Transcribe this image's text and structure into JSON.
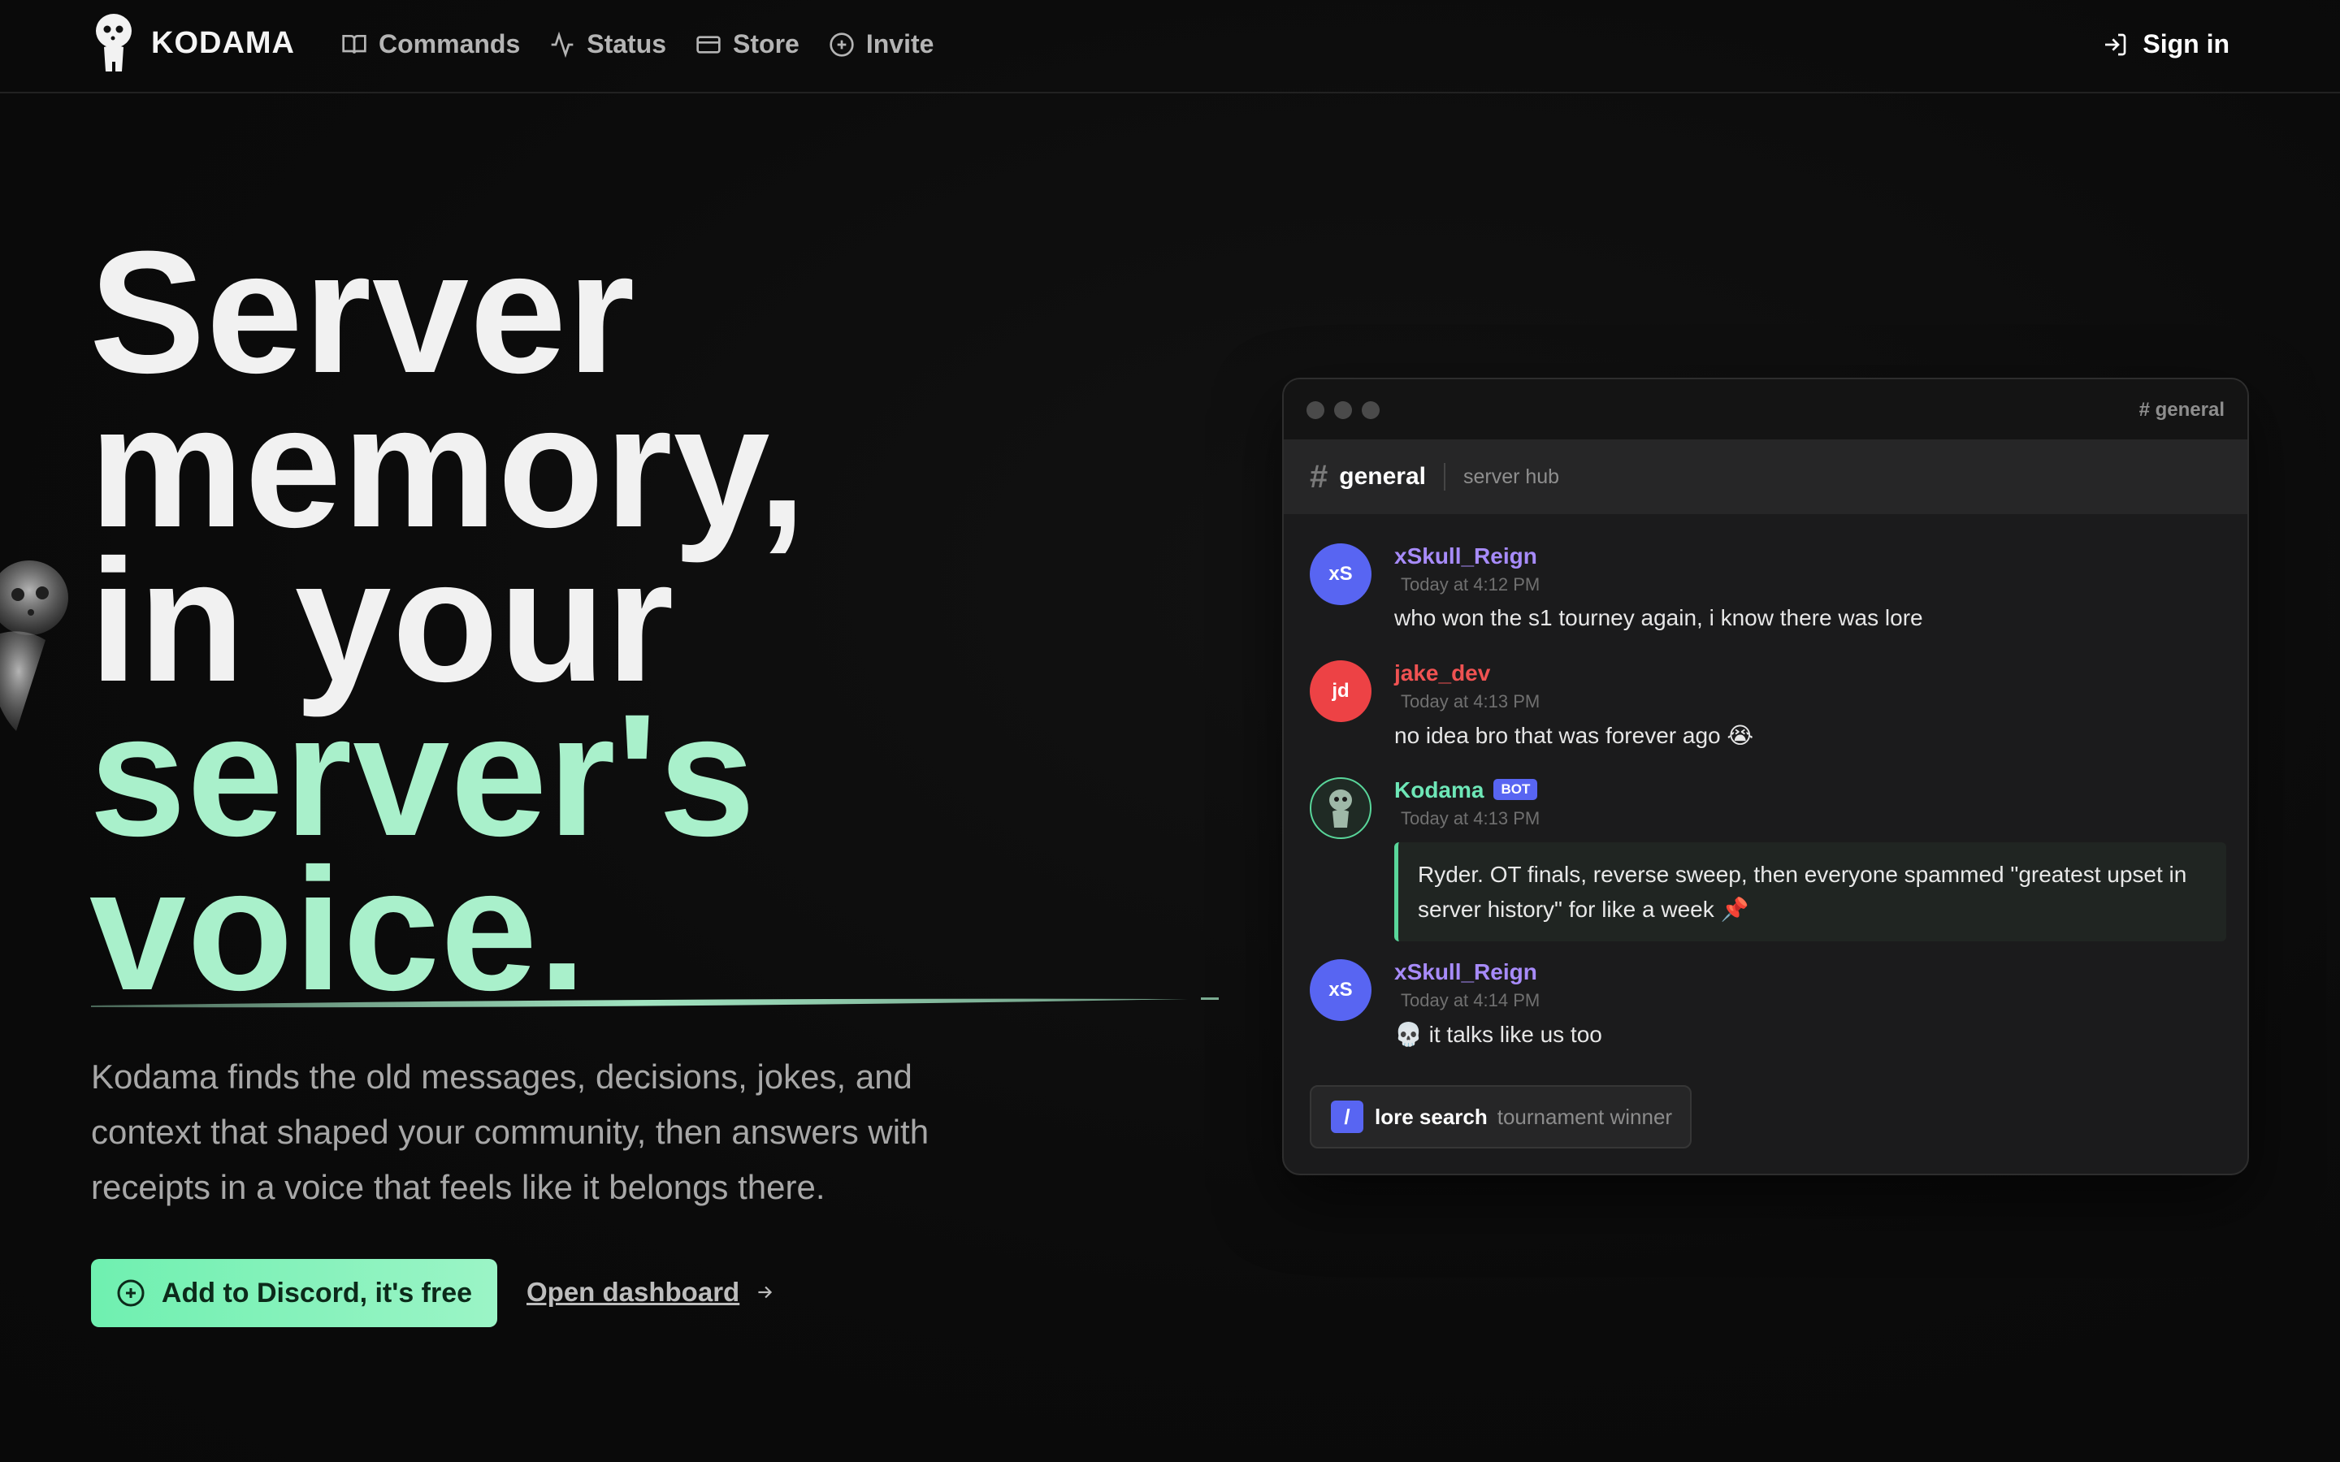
{
  "nav": {
    "brand": "KODAMA",
    "links": [
      {
        "label": "Commands",
        "icon": "book-icon"
      },
      {
        "label": "Status",
        "icon": "activity-icon"
      },
      {
        "label": "Store",
        "icon": "credit-card-icon"
      },
      {
        "label": "Invite",
        "icon": "plus-circle-icon"
      }
    ],
    "signin": "Sign in"
  },
  "hero": {
    "title_lines": [
      "Server",
      "memory,",
      "in your",
      "server's",
      "voice."
    ],
    "description": "Kodama finds the old messages, decisions, jokes, and context that shaped your community, then answers with receipts in a voice that feels like it belongs there.",
    "cta_label": "Add to Discord, it's free",
    "dashboard_label": "Open dashboard"
  },
  "chat": {
    "window_tag": "# general",
    "channel": {
      "hash": "#",
      "name": "general",
      "subtitle": "server hub"
    },
    "messages": [
      {
        "user": "xSkull_Reign",
        "initials": "xS",
        "time": "Today at 4:12 PM",
        "text": "who won the s1 tourney again, i know there was lore",
        "color": "#a78bfa",
        "avatar_color": "#5865f2"
      },
      {
        "user": "jake_dev",
        "initials": "jd",
        "time": "Today at 4:13 PM",
        "text": "no idea bro that was forever ago 😭",
        "color": "#f05252",
        "avatar_color": "#ed4245"
      },
      {
        "user": "Kodama",
        "badge": "BOT",
        "time": "Today at 4:13 PM",
        "text": "Ryder. OT finals, reverse sweep, then everyone spammed \"greatest upset in server history\" for like a week 📌",
        "color": "#6ee7b7"
      },
      {
        "user": "xSkull_Reign",
        "initials": "xS",
        "time": "Today at 4:14 PM",
        "text": "💀 it talks like us too",
        "color": "#a78bfa",
        "avatar_color": "#5865f2"
      }
    ],
    "command": {
      "slash": "/",
      "name": "lore search",
      "arg": "tournament winner"
    }
  },
  "colors": {
    "accent": "#6ff0b0",
    "background": "#0b0b0b",
    "discord_blurple": "#5865f2"
  }
}
